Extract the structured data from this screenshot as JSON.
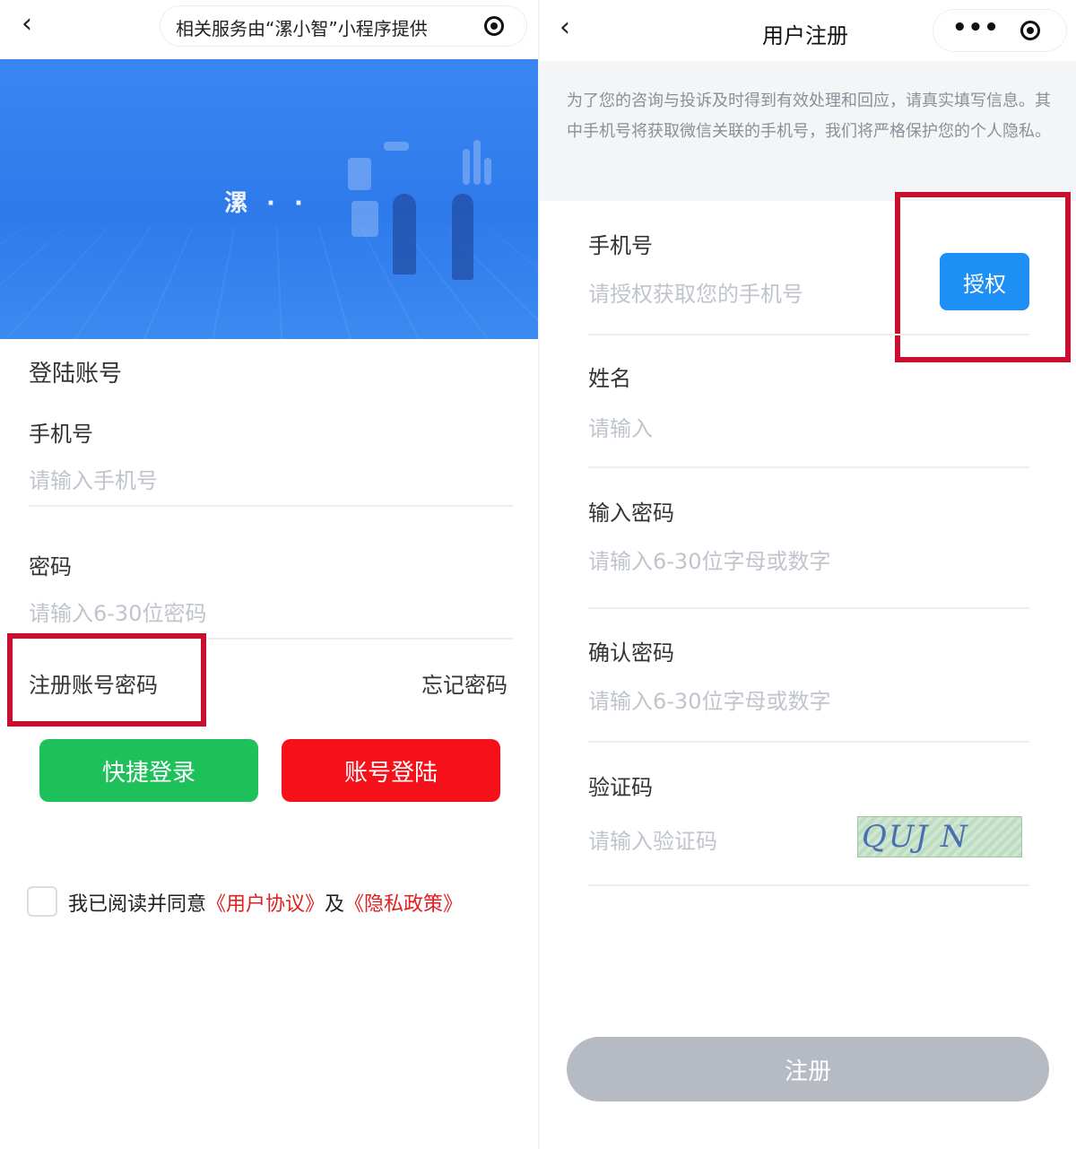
{
  "left": {
    "nav": {
      "back_icon": "‹",
      "title": "相关服务由“漯小智”小程序提供"
    },
    "banner": {
      "logo_text": "漯 · ·"
    },
    "section_title": "登陆账号",
    "phone": {
      "label": "手机号",
      "placeholder": "请输入手机号"
    },
    "password": {
      "label": "密码",
      "placeholder": "请输入6-30位密码"
    },
    "register_link": "注册账号密码",
    "forgot_link": "忘记密码",
    "quick_login": "快捷登录",
    "account_login": "账号登陆",
    "agreement": {
      "prefix": "我已阅读并同意",
      "user_agreement": "《用户协议》",
      "and": "及",
      "privacy_policy": "《隐私政策》"
    },
    "colors": {
      "green": "#1ec05a",
      "red": "#f5101a",
      "banner": "#3a86f1"
    }
  },
  "right": {
    "nav": {
      "back_icon": "‹",
      "title": "用户注册",
      "more_icon": "•••"
    },
    "notice": "为了您的咨询与投诉及时得到有效处理和回应，请真实填写信息。其中手机号将获取微信关联的手机号，我们将严格保护您的个人隐私。",
    "phone": {
      "label": "手机号",
      "placeholder": "请授权获取您的手机号",
      "auth_button": "授权"
    },
    "name": {
      "label": "姓名",
      "placeholder": "请输入"
    },
    "password": {
      "label": "输入密码",
      "placeholder": "请输入6-30位字母或数字"
    },
    "confirm": {
      "label": "确认密码",
      "placeholder": "请输入6-30位字母或数字"
    },
    "captcha": {
      "label": "验证码",
      "placeholder": "请输入验证码",
      "image_text": "QUJ N"
    },
    "submit": "注册",
    "colors": {
      "auth": "#1e90f5",
      "submit_disabled": "#b6bac3"
    }
  }
}
